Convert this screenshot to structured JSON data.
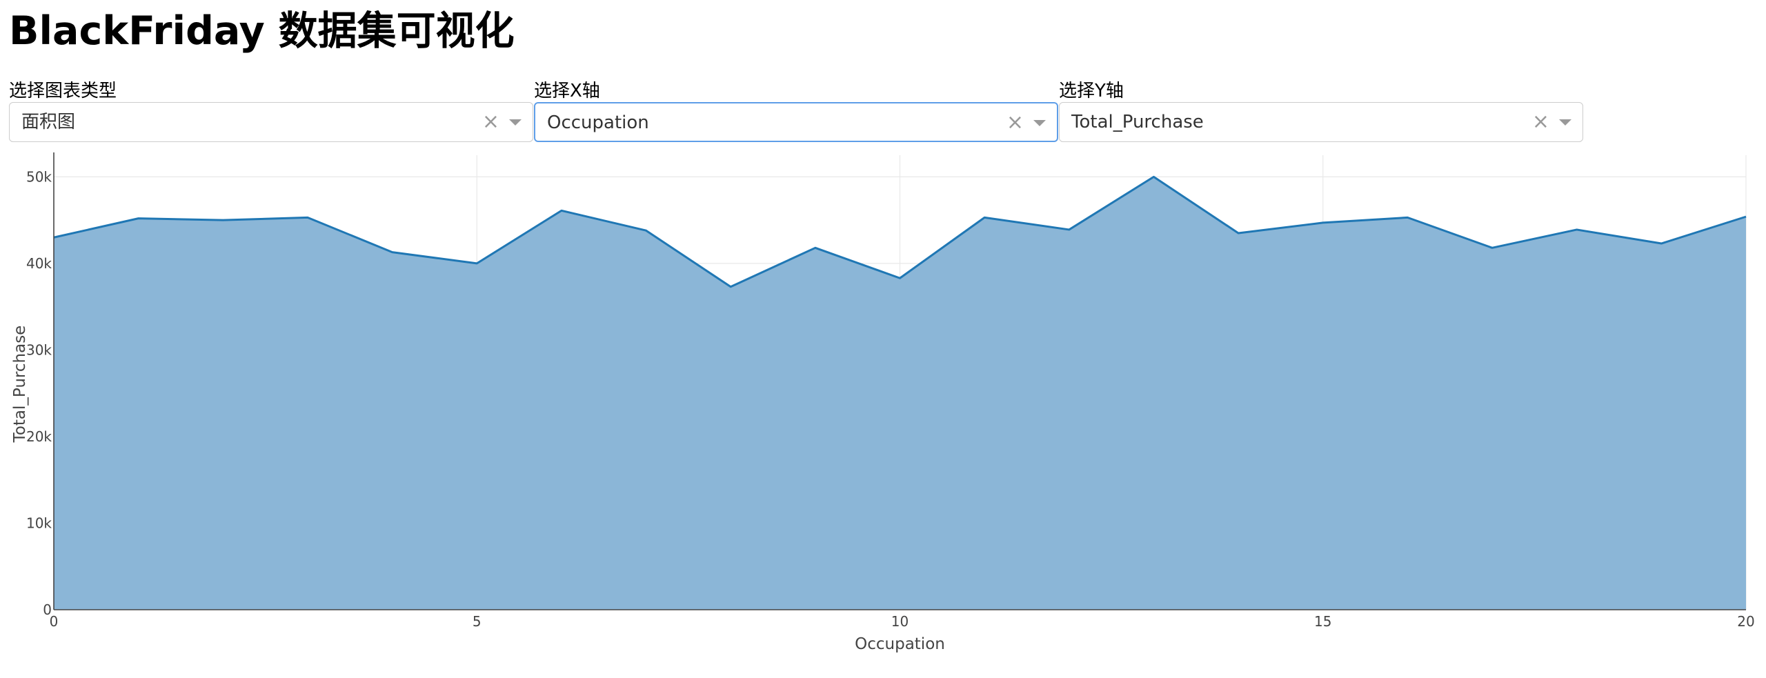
{
  "page": {
    "title": "BlackFriday 数据集可视化"
  },
  "controls": [
    {
      "label": "选择图表类型",
      "value": "面积图",
      "clear_icon": "×"
    },
    {
      "label": "选择X轴",
      "value": "Occupation",
      "clear_icon": "×"
    },
    {
      "label": "选择Y轴",
      "value": "Total_Purchase",
      "clear_icon": "×"
    }
  ],
  "chart_data": {
    "type": "area",
    "xlabel": "Occupation",
    "ylabel": "Total_Purchase",
    "x": [
      0,
      1,
      2,
      3,
      4,
      5,
      6,
      7,
      8,
      9,
      10,
      11,
      12,
      13,
      14,
      15,
      16,
      17,
      18,
      19,
      20
    ],
    "y": [
      43000,
      45200,
      45000,
      45300,
      41300,
      40000,
      46100,
      43800,
      37300,
      41800,
      38300,
      45300,
      43900,
      50000,
      43500,
      44700,
      45300,
      41800,
      43900,
      42300,
      45400
    ],
    "xlim": [
      0,
      20
    ],
    "ylim": [
      0,
      52500
    ],
    "xticks": [
      0,
      5,
      10,
      15,
      20
    ],
    "xtick_labels": [
      "0",
      "5",
      "10",
      "15",
      "20"
    ],
    "yticks": [
      0,
      10000,
      20000,
      30000,
      40000,
      50000
    ],
    "ytick_labels": [
      "0",
      "10k",
      "20k",
      "30k",
      "40k",
      "50k"
    ],
    "grid": true,
    "colors": {
      "line": "#1f77b4",
      "fill": "#8bb6d7",
      "grid": "#e8e8e8",
      "axis": "#444444"
    }
  }
}
